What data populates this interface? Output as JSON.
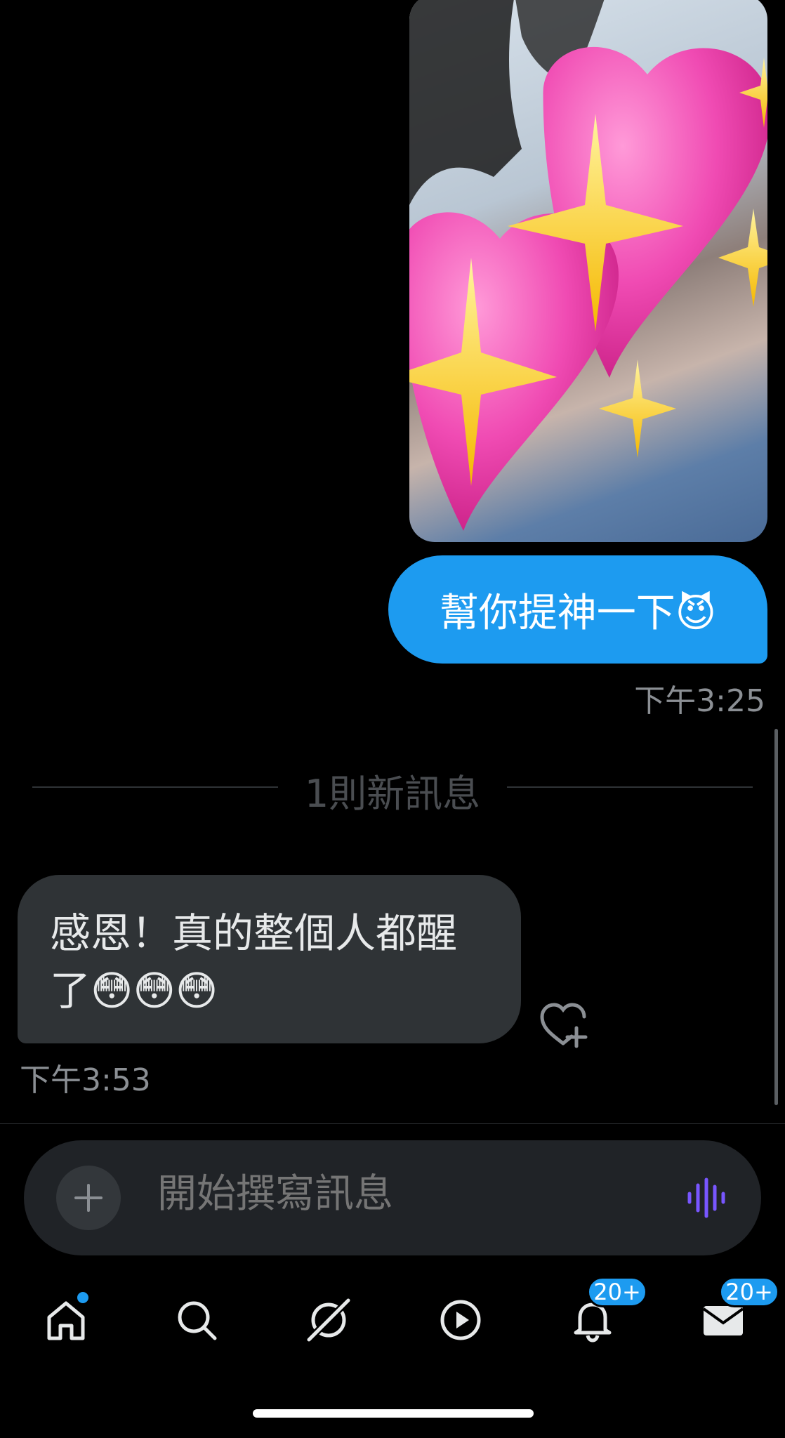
{
  "thread": {
    "outgoing_text": "幫你提神一下😈",
    "outgoing_time": "下午3:25",
    "new_messages_divider": "1則新訊息",
    "incoming_text_line1": "感恩！真的整個人都醒",
    "incoming_text_line2": "了😳😳😳",
    "incoming_time": "下午3:53"
  },
  "composer": {
    "placeholder": "開始撰寫訊息"
  },
  "tabbar": {
    "notifications_badge": "20+",
    "messages_badge": "20+"
  },
  "colors": {
    "accent": "#1d9bf0",
    "incoming_bubble": "#2f3336",
    "voice_icon": "#7856ff"
  }
}
